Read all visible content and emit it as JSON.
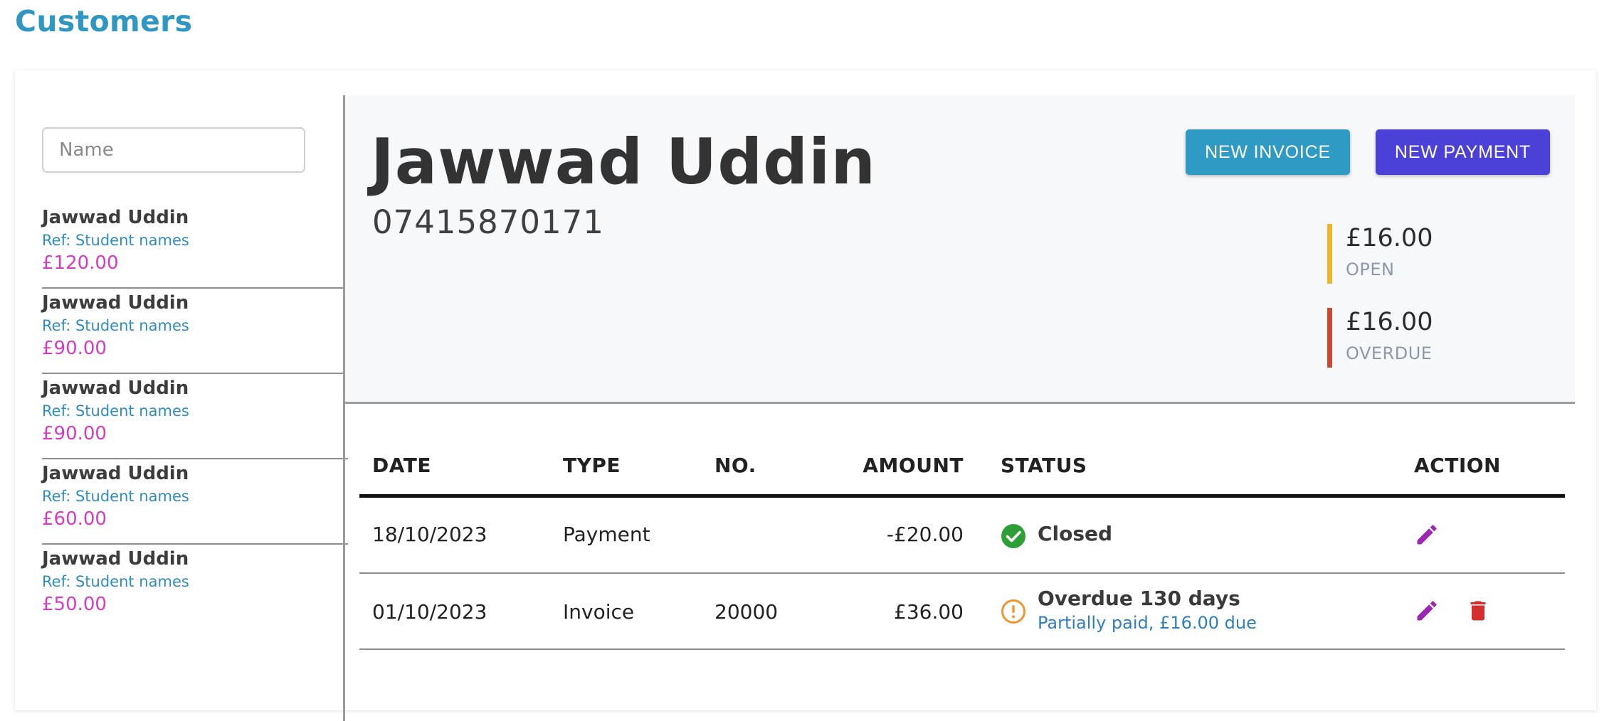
{
  "page": {
    "title": "Customers"
  },
  "sidebar": {
    "search_placeholder": "Name",
    "customers": [
      {
        "name": "Jawwad Uddin",
        "ref": "Ref: Student names",
        "amount": "£120.00"
      },
      {
        "name": "Jawwad Uddin",
        "ref": "Ref: Student names",
        "amount": "£90.00"
      },
      {
        "name": "Jawwad Uddin",
        "ref": "Ref: Student names",
        "amount": "£90.00"
      },
      {
        "name": "Jawwad Uddin",
        "ref": "Ref: Student names",
        "amount": "£60.00"
      },
      {
        "name": "Jawwad Uddin",
        "ref": "Ref: Student names",
        "amount": "£50.00"
      }
    ]
  },
  "customer": {
    "name": "Jawwad Uddin",
    "phone": "07415870171",
    "new_invoice_label": "NEW INVOICE",
    "new_payment_label": "NEW PAYMENT",
    "open": {
      "amount": "£16.00",
      "label": "OPEN",
      "color": "#f0b429"
    },
    "overdue": {
      "amount": "£16.00",
      "label": "OVERDUE",
      "color": "#c94a30"
    }
  },
  "table": {
    "headers": {
      "date": "DATE",
      "type": "TYPE",
      "no": "NO.",
      "amount": "AMOUNT",
      "status": "STATUS",
      "action": "ACTION"
    },
    "rows": [
      {
        "date": "18/10/2023",
        "type": "Payment",
        "no": "",
        "amount": "-£20.00",
        "status": "Closed",
        "status_sub": "",
        "status_icon": "check-circle-icon",
        "actions": [
          "edit-icon"
        ]
      },
      {
        "date": "01/10/2023",
        "type": "Invoice",
        "no": "20000",
        "amount": "£36.00",
        "status": "Overdue 130 days",
        "status_sub": "Partially paid, £16.00 due",
        "status_icon": "warning-circle-icon",
        "actions": [
          "edit-icon",
          "delete-icon"
        ]
      }
    ]
  },
  "colors": {
    "brand": "#2f97c1",
    "payment_button": "#4b41d9",
    "amount_pink": "#d63cc0",
    "edit_icon": "#9c27b0",
    "delete_icon": "#d32f2f",
    "closed_green": "#2e9e36",
    "overdue_orange": "#f0962e"
  }
}
